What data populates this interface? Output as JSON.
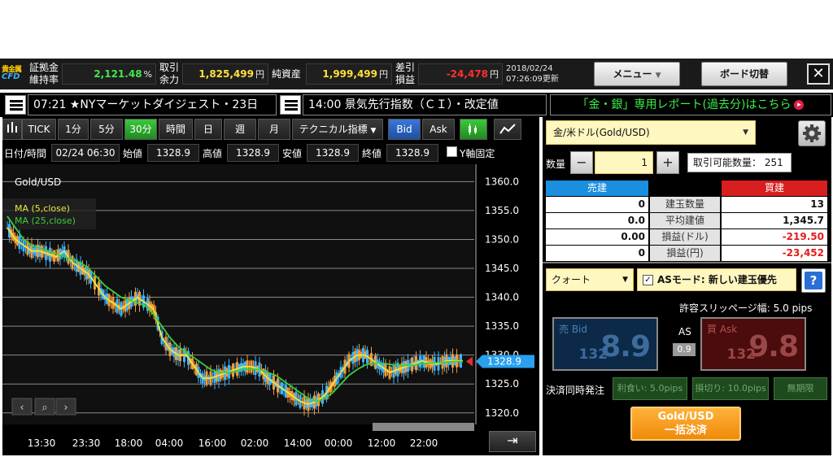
{
  "topbar": {
    "logo_line1": "貴金属",
    "logo_line2": "CFD",
    "margin_label_1": "証拠金",
    "margin_label_2": "維持率",
    "margin_value": "2,121.48",
    "margin_unit": "%",
    "capacity_label_1": "取引",
    "capacity_label_2": "余力",
    "capacity_value": "1,825,499",
    "capacity_unit": "円",
    "net_assets_label": "純資産",
    "net_assets_value": "1,999,499",
    "net_assets_unit": "円",
    "pnl_label_1": "差引",
    "pnl_label_2": "損益",
    "pnl_value": "-24,478",
    "pnl_unit": "円",
    "updated_date": "2018/02/24",
    "updated_time": "07:26:09更新",
    "menu_label": "メニュー",
    "board_label": "ボード切替",
    "close_label": "✕"
  },
  "news": {
    "item1": "07:21 ★NYマーケットダイジェスト・23日",
    "item2": "14:00 景気先行指数（ＣＩ）・改定値",
    "report_link": "「金・銀」専用レポート(過去分)はこちら"
  },
  "toolbar": {
    "tick": "TICK",
    "m1": "1分",
    "m5": "5分",
    "m30": "30分",
    "h1": "時間",
    "day": "日",
    "week": "週",
    "month": "月",
    "technical": "テクニカル指標",
    "bid": "Bid",
    "ask": "Ask"
  },
  "ohlc": {
    "datetime_label": "日付/時間",
    "datetime_value": "02/24 06:30",
    "open_label": "始値",
    "open_value": "1328.9",
    "high_label": "高値",
    "high_value": "1328.9",
    "low_label": "安値",
    "low_value": "1328.9",
    "close_label": "終値",
    "close_value": "1328.9",
    "yfix_label": "Y軸固定"
  },
  "chart_data": {
    "type": "line",
    "symbol_label": "Gold/USD",
    "ylim": [
      1318,
      1363
    ],
    "y_ticks": [
      "1360.0",
      "1355.0",
      "1350.0",
      "1345.0",
      "1340.0",
      "1335.0",
      "1330.0",
      "1325.0",
      "1320.0"
    ],
    "x_ticks": [
      "13:30",
      "23:30",
      "18:00",
      "04:00",
      "16:00",
      "02:00",
      "14:00",
      "00:00",
      "12:00",
      "22:00"
    ],
    "current_price_label": "1328.9",
    "grid": true,
    "legend_position": "top-left",
    "series": [
      {
        "name": "MA (5,close)",
        "color": "#e8e640",
        "values": [
          1352,
          1350,
          1349,
          1348,
          1348,
          1347.5,
          1347,
          1348,
          1346,
          1345,
          1344,
          1342,
          1340,
          1339,
          1338,
          1339,
          1340,
          1339,
          1338,
          1333,
          1331,
          1330,
          1330,
          1328,
          1326,
          1326,
          1326.5,
          1327,
          1327.5,
          1328,
          1328,
          1327.5,
          1326,
          1325,
          1324,
          1323,
          1322,
          1321.5,
          1322,
          1323,
          1325,
          1327,
          1329,
          1330,
          1330,
          1329,
          1328,
          1327,
          1327.5,
          1328,
          1328.5,
          1329,
          1328.5,
          1328.5,
          1329,
          1329,
          1329
        ]
      },
      {
        "name": "MA (25,close)",
        "color": "#3ccf3c",
        "values": [
          1354,
          1352,
          1350,
          1349,
          1348.5,
          1348,
          1347.5,
          1347,
          1346.5,
          1346,
          1345,
          1343.5,
          1342,
          1341,
          1340,
          1339.5,
          1339,
          1338.5,
          1337,
          1335,
          1333,
          1331.5,
          1330.5,
          1329.5,
          1328.5,
          1327.5,
          1327,
          1327,
          1327.2,
          1327.5,
          1327.6,
          1327.5,
          1327,
          1326.5,
          1325.5,
          1324.5,
          1323.5,
          1322.5,
          1322,
          1322.5,
          1323.5,
          1325,
          1326.5,
          1327.5,
          1328.3,
          1328.6,
          1328.6,
          1328.4,
          1328.2,
          1328.2,
          1328.3,
          1328.5,
          1328.6,
          1328.7,
          1328.8,
          1328.9,
          1328.9
        ]
      }
    ]
  },
  "order": {
    "symbol": "金/米ドル(Gold/USD)",
    "qty_label": "数量",
    "qty_minus": "−",
    "qty_value": "1",
    "qty_plus": "+",
    "available_label": "取引可能数量：",
    "available_value": "251",
    "positions": {
      "sell_header": "売建",
      "buy_header": "買建",
      "rows": [
        {
          "label": "建玉数量",
          "sell": "0",
          "buy": "13"
        },
        {
          "label": "平均建値",
          "sell": "0.0",
          "buy": "1,345.7"
        },
        {
          "label": "損益(ドル)",
          "sell": "0.00",
          "buy": "-219.50"
        },
        {
          "label": "損益(円)",
          "sell": "0",
          "buy": "-23,452"
        }
      ]
    },
    "order_type": "クォート",
    "as_mode": "ASモード: 新しい建玉優先",
    "as_check": "✓",
    "help": "?",
    "slippage_label": "許容スリッページ幅:",
    "slippage_value": "5.0",
    "slippage_unit": "pips",
    "sell_label": "売 Bid",
    "sell_big": "8.9",
    "sell_small": "132",
    "buy_label": "買 Ask",
    "buy_big": "9.8",
    "buy_small": "132",
    "as_label": "AS",
    "as_value": "0.9",
    "simultaneous_label": "決済同時発注",
    "take_profit": "利食い: 5.0pips",
    "stop_loss": "損切り: 10.0pips",
    "unlimited": "無期限",
    "settle_line1": "Gold/USD",
    "settle_line2": "一括決済"
  }
}
